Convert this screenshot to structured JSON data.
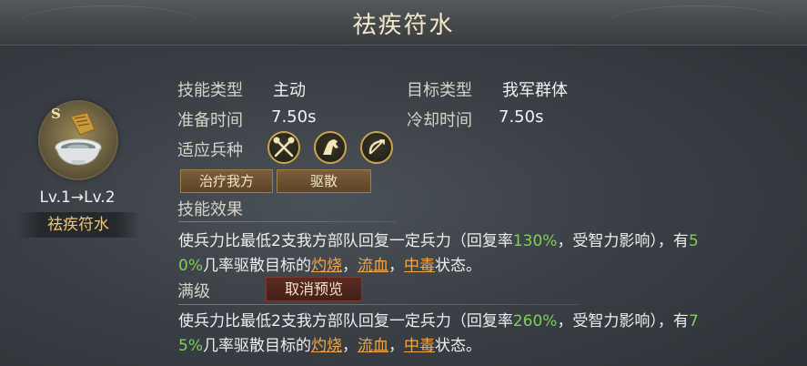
{
  "title": "祛疾符水",
  "skill": {
    "grade": "S",
    "level_text": "Lv.1→Lv.2",
    "name": "祛疾符水",
    "icon": "water-bowl-icon"
  },
  "info": {
    "skill_type_label": "技能类型",
    "skill_type_value": "主动",
    "target_type_label": "目标类型",
    "target_type_value": "我军群体",
    "prep_time_label": "准备时间",
    "prep_time_value": "7.50s",
    "cooldown_label": "冷却时间",
    "cooldown_value": "7.50s",
    "troop_label": "适应兵种",
    "troops": [
      "crossed-weapons-icon",
      "horse-icon",
      "bow-icon"
    ]
  },
  "tags": [
    "治疗我方",
    "驱散"
  ],
  "effect_label": "技能效果",
  "effect": {
    "line1_a": "使兵力比最低2支我方部队回复一定兵力（回复率",
    "rate": "130%",
    "line1_b": "，受智力影响），有",
    "chance_1": "5",
    "chance_2": "0%",
    "line2_a": "几率驱散目标的",
    "burn": "灼烧",
    "sep1": "，",
    "bleed": "流血",
    "sep2": "，",
    "poison": "中毒",
    "line2_b": "状态。"
  },
  "max_label": "满级",
  "cancel_preview": "取消预览",
  "max_effect": {
    "line1_a": "使兵力比最低2支我方部队回复一定兵力（回复率",
    "rate": "260%",
    "line1_b": "，受智力影响），有",
    "chance_1": "7",
    "chance_2": "5%",
    "line2_a": "几率驱散目标的",
    "burn": "灼烧",
    "sep1": "，",
    "bleed": "流血",
    "sep2": "，",
    "poison": "中毒",
    "line2_b": "状态。"
  },
  "colors": {
    "highlight_green": "#7fcf5a",
    "status_orange": "#f0a64a",
    "name_gold": "#f3c86a"
  }
}
